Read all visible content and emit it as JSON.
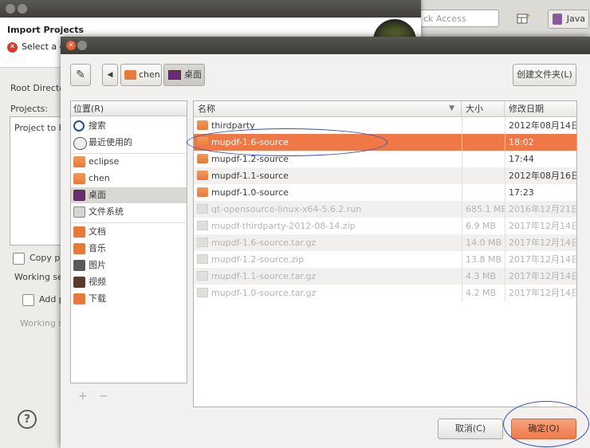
{
  "eclipse": {
    "quick_access": "ck Access",
    "perspective_java": "Java"
  },
  "import_dialog": {
    "title": "Import Projects",
    "error_text": "Select a d",
    "root_dir_label": "Root Directo",
    "projects_label": "Projects:",
    "project_item": "Project to Im",
    "copy_label": "Copy pro",
    "working_label": "Working set",
    "add_label": "Add p",
    "working_set_label": "Working se",
    "help": "?"
  },
  "file_chooser": {
    "breadcrumbs": [
      "chen",
      "桌面"
    ],
    "new_folder_button": "创建文件夹(L)",
    "places_header": "位置(R)",
    "places": [
      {
        "label": "搜索",
        "icon": "search-icon"
      },
      {
        "label": "最近使用的",
        "icon": "recent-icon"
      },
      {
        "label": "eclipse",
        "icon": "folder-icon"
      },
      {
        "label": "chen",
        "icon": "home-icon"
      },
      {
        "label": "桌面",
        "icon": "desktop-icon"
      },
      {
        "label": "文件系统",
        "icon": "drive-icon"
      },
      {
        "label": "文档",
        "icon": "documents-icon"
      },
      {
        "label": "音乐",
        "icon": "music-icon"
      },
      {
        "label": "图片",
        "icon": "pictures-icon"
      },
      {
        "label": "视频",
        "icon": "videos-icon"
      },
      {
        "label": "下载",
        "icon": "downloads-icon"
      }
    ],
    "places_add": "+",
    "places_remove": "−",
    "columns": {
      "name": "名称",
      "size": "大小",
      "modified": "修改日期"
    },
    "files": [
      {
        "name": "thirdparty",
        "size": "",
        "modified": "2012年08月14日",
        "type": "folder",
        "dim": false
      },
      {
        "name": "mupdf-1.6-source",
        "size": "",
        "modified": "18:02",
        "type": "folder",
        "dim": false
      },
      {
        "name": "mupdf-1.2-source",
        "size": "",
        "modified": "17:44",
        "type": "folder",
        "dim": false
      },
      {
        "name": "mupdf-1.1-source",
        "size": "",
        "modified": "2012年08月16日",
        "type": "folder",
        "dim": false
      },
      {
        "name": "mupdf-1.0-source",
        "size": "",
        "modified": "17:23",
        "type": "folder",
        "dim": false
      },
      {
        "name": "qt-opensource-linux-x64-5.6.2.run",
        "size": "685.1 MB",
        "modified": "2016年12月21日",
        "type": "file",
        "dim": true
      },
      {
        "name": "mupdf-thirdparty-2012-08-14.zip",
        "size": "6.9 MB",
        "modified": "2017年12月14日",
        "type": "file",
        "dim": true
      },
      {
        "name": "mupdf-1.6-source.tar.gz",
        "size": "14.0 MB",
        "modified": "2017年12月14日",
        "type": "file",
        "dim": true
      },
      {
        "name": "mupdf-1.2-source.zip",
        "size": "13.8 MB",
        "modified": "2017年12月14日",
        "type": "file",
        "dim": true
      },
      {
        "name": "mupdf-1.1-source.tar.gz",
        "size": "4.3 MB",
        "modified": "2017年12月14日",
        "type": "file",
        "dim": true
      },
      {
        "name": "mupdf-1.0-source.tar.gz",
        "size": "4.2 MB",
        "modified": "2017年12月14日",
        "type": "file",
        "dim": true
      }
    ],
    "selected_index": 1,
    "cancel_button": "取消(C)",
    "ok_button": "确定(O)"
  },
  "colors": {
    "selection": "#f07746",
    "annotation": "#2c4fc6"
  }
}
